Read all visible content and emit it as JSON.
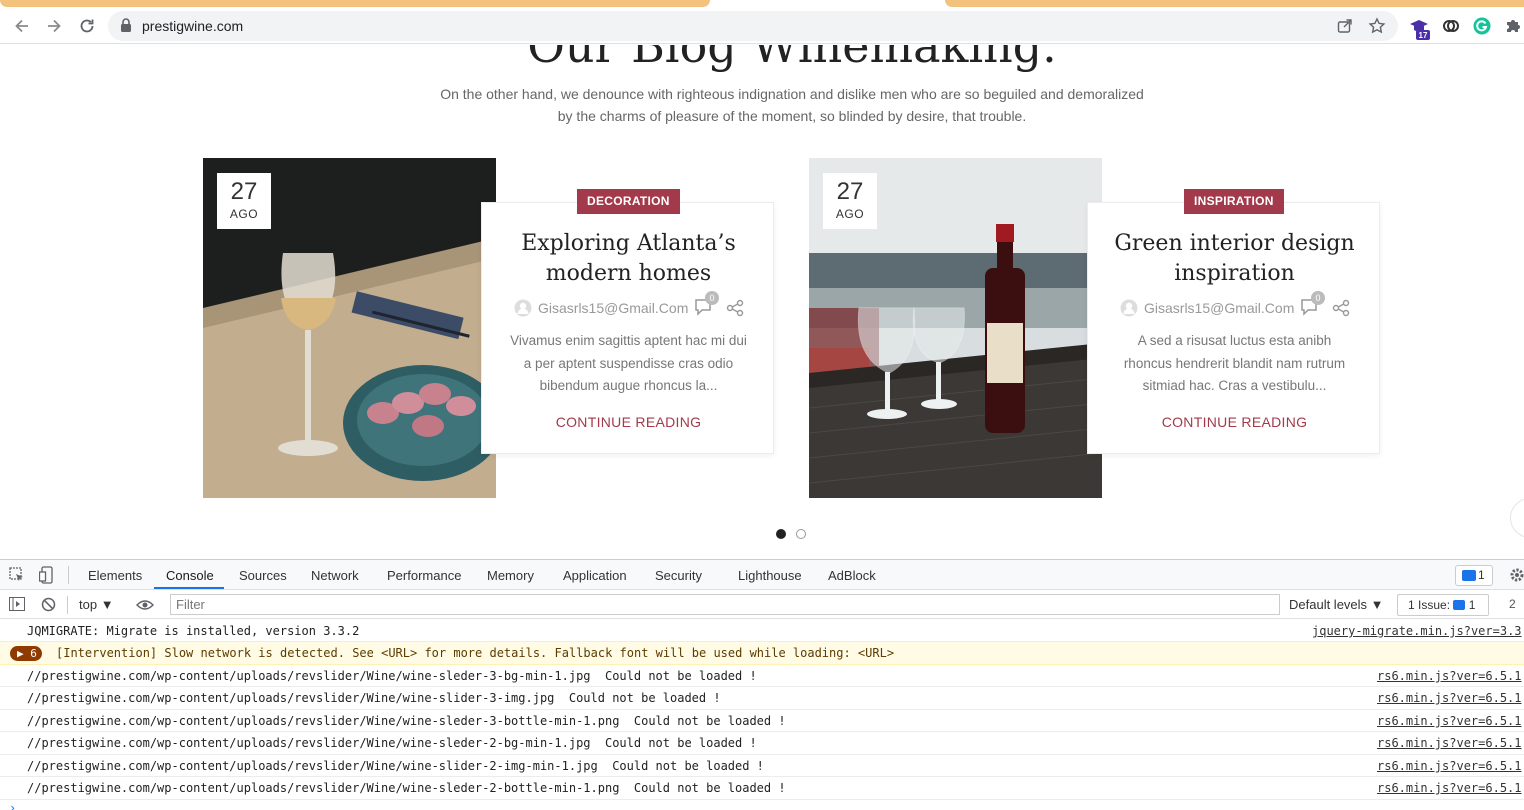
{
  "browser": {
    "url": "prestigwine.com",
    "extension_badge": "17"
  },
  "page": {
    "heading": "Our Blog Winemaking.",
    "intro": "On the other hand, we denounce with righteous indignation and dislike men who are so beguiled and demoralized by the charms of pleasure of the moment, so blinded by desire, that trouble.",
    "posts": [
      {
        "day": "27",
        "month": "AGO",
        "category": "DECORATION",
        "title": "Exploring Atlanta’s modern homes",
        "author": "Gisasrls15@Gmail.Com",
        "comments": "0",
        "excerpt": "Vivamus enim sagittis aptent hac mi dui a per aptent suspendisse cras odio bibendum augue rhoncus la...",
        "cta": "CONTINUE READING"
      },
      {
        "day": "27",
        "month": "AGO",
        "category": "INSPIRATION",
        "title": "Green interior design inspiration",
        "author": "Gisasrls15@Gmail.Com",
        "comments": "0",
        "excerpt": "A sed a risusat luctus esta anibh rhoncus hendrerit blandit nam rutrum sitmiad hac. Cras a vestibulu...",
        "cta": "CONTINUE READING"
      }
    ],
    "pager": {
      "active_index": 0,
      "count": 2
    }
  },
  "devtools": {
    "tabs": [
      "Elements",
      "Console",
      "Sources",
      "Network",
      "Performance",
      "Memory",
      "Application",
      "Security",
      "Lighthouse",
      "AdBlock"
    ],
    "active_tab": "Console",
    "messages_badge": "1",
    "context": "top",
    "filter_placeholder": "Filter",
    "levels": "Default levels",
    "issues_label": "1 Issue:",
    "issues_count": "1",
    "hidden_count": "2",
    "logs": [
      {
        "text": "JQMIGRATE: Migrate is installed, version 3.3.2",
        "source": "jquery-migrate.min.js?ver=3.3"
      },
      {
        "count": "6",
        "text": "[Intervention] Slow network is detected. See <URL> for more details. Fallback font will be used while loading: <URL>",
        "level": "warning"
      },
      {
        "text": "//prestigwine.com/wp-content/uploads/revslider/Wine/wine-sleder-3-bg-min-1.jpg  Could not be loaded !",
        "source": "rs6.min.js?ver=6.5.1"
      },
      {
        "text": "//prestigwine.com/wp-content/uploads/revslider/Wine/wine-slider-3-img.jpg  Could not be loaded !",
        "source": "rs6.min.js?ver=6.5.1"
      },
      {
        "text": "//prestigwine.com/wp-content/uploads/revslider/Wine/wine-sleder-3-bottle-min-1.png  Could not be loaded !",
        "source": "rs6.min.js?ver=6.5.1"
      },
      {
        "text": "//prestigwine.com/wp-content/uploads/revslider/Wine/wine-sleder-2-bg-min-1.jpg  Could not be loaded !",
        "source": "rs6.min.js?ver=6.5.1"
      },
      {
        "text": "//prestigwine.com/wp-content/uploads/revslider/Wine/wine-slider-2-img-min-1.jpg  Could not be loaded !",
        "source": "rs6.min.js?ver=6.5.1"
      },
      {
        "text": "//prestigwine.com/wp-content/uploads/revslider/Wine/wine-sleder-2-bottle-min-1.png  Could not be loaded !",
        "source": "rs6.min.js?ver=6.5.1"
      }
    ]
  },
  "colors": {
    "accent": "#a33a4b",
    "tab_accent": "#f3c27c",
    "devtools_blue": "#1a73e8"
  }
}
